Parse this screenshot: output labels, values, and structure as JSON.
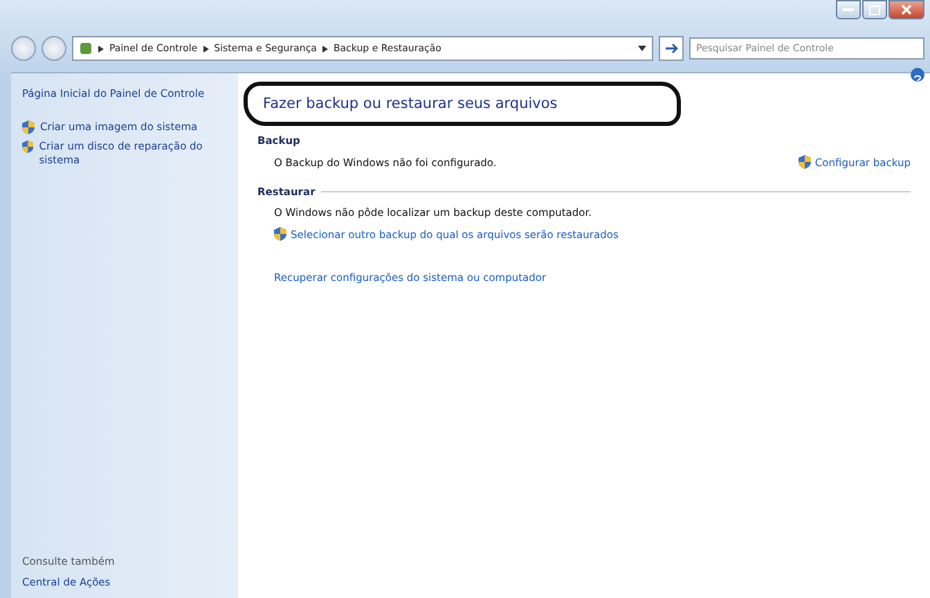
{
  "address_bar": {
    "crumbs": [
      "Painel de Controle",
      "Sistema e Segurança",
      "Backup e Restauração"
    ]
  },
  "search": {
    "placeholder": "Pesquisar Painel de Controle"
  },
  "sidebar": {
    "home": "Página Inicial do Painel de Controle",
    "items": [
      {
        "label": "Criar uma imagem do sistema"
      },
      {
        "label": "Criar um disco de reparação do sistema"
      }
    ],
    "see_also": {
      "heading": "Consulte também",
      "items": [
        "Central de Ações"
      ]
    }
  },
  "main": {
    "title": "Fazer backup ou restaurar seus arquivos",
    "backup": {
      "heading": "Backup",
      "status": "O Backup do Windows não foi configurado.",
      "action": "Configurar backup"
    },
    "restore": {
      "heading": "Restaurar",
      "status": "O Windows não pôde localizar um backup deste computador.",
      "link": "Selecionar outro backup do qual os arquivos serão restaurados"
    },
    "recover_link": "Recuperar configurações do sistema ou computador"
  }
}
